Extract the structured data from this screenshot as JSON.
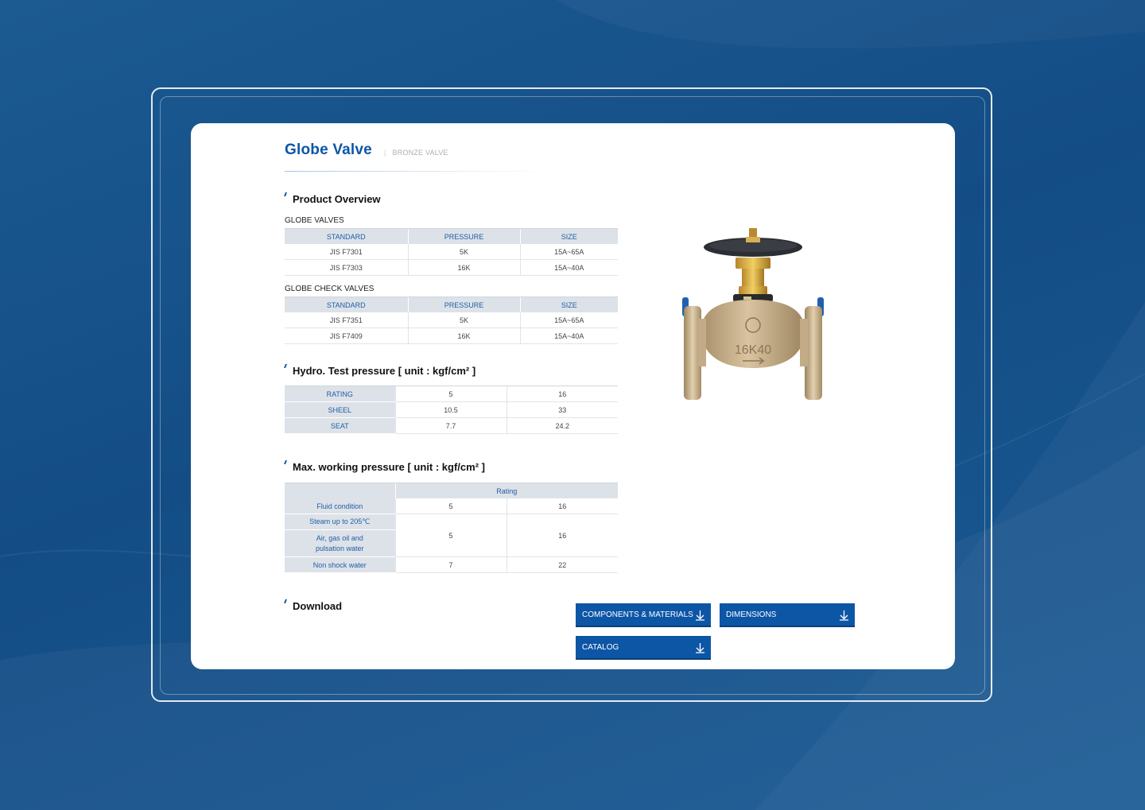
{
  "header": {
    "title": "Globe Valve",
    "separator": "|",
    "category": "BRONZE VALVE"
  },
  "overview": {
    "heading": "Product Overview",
    "globe_valves": {
      "label": "GLOBE VALVES",
      "columns": [
        "STANDARD",
        "PRESSURE",
        "SIZE"
      ],
      "rows": [
        [
          "JIS F7301",
          "5K",
          "15A~65A"
        ],
        [
          "JIS F7303",
          "16K",
          "15A~40A"
        ]
      ]
    },
    "globe_check_valves": {
      "label": "GLOBE CHECK VALVES",
      "columns": [
        "STANDARD",
        "PRESSURE",
        "SIZE"
      ],
      "rows": [
        [
          "JIS F7351",
          "5K",
          "15A~65A"
        ],
        [
          "JIS F7409",
          "16K",
          "15A~40A"
        ]
      ]
    }
  },
  "hydro": {
    "heading": "Hydro. Test pressure [ unit : kgf/cm² ]",
    "rows": [
      [
        "RATING",
        "5",
        "16"
      ],
      [
        "SHEEL",
        "10.5",
        "33"
      ],
      [
        "SEAT",
        "7.7",
        "24.2"
      ]
    ]
  },
  "max_working": {
    "heading": "Max. working pressure [ unit : kgf/cm² ]",
    "rating_header": "Rating",
    "rows": {
      "fluid": [
        "Fluid condition",
        "5",
        "16"
      ],
      "steam_label": "Steam up to 205℃",
      "air_label": "Air, gas oil and pulsation water",
      "steam_air_values": [
        "5",
        "16"
      ],
      "non_shock": [
        "Non shock water",
        "7",
        "22"
      ]
    }
  },
  "valve_marking": "16K40",
  "download": {
    "heading": "Download",
    "buttons": {
      "components": "COMPONENTS & MATERIALS",
      "dimensions": "DIMENSIONS",
      "catalog": "CATALOG"
    }
  },
  "colors": {
    "brand_blue": "#0d56a6",
    "background_blue": "#144d85",
    "table_header_bg": "#dde2e8"
  }
}
